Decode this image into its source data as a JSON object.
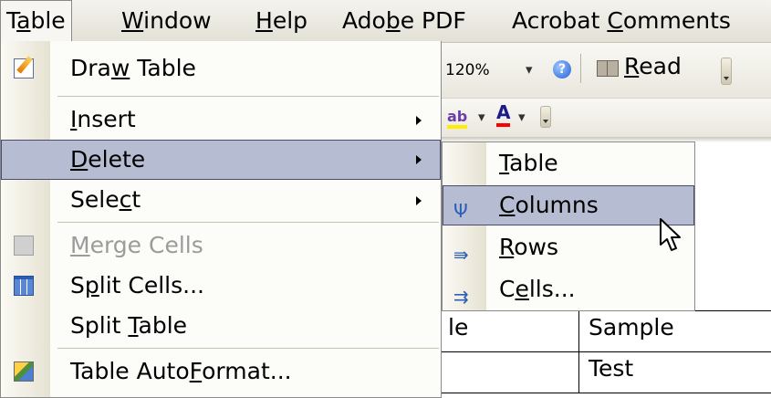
{
  "menubar": {
    "items": [
      {
        "pre": "T",
        "key": "a",
        "post": "ble"
      },
      {
        "pre": "",
        "key": "W",
        "post": "indow"
      },
      {
        "pre": "",
        "key": "H",
        "post": "elp"
      },
      {
        "pre": "Ado",
        "key": "b",
        "post": "e PDF"
      },
      {
        "pre": "Acrobat ",
        "key": "C",
        "post": "omments"
      }
    ]
  },
  "toolbar": {
    "zoom": "120%",
    "read": {
      "pre": "",
      "key": "R",
      "post": "ead"
    }
  },
  "table_menu": {
    "items": [
      {
        "pre": "Dra",
        "key": "w",
        "post": " Table",
        "icon": "draw-table-icon"
      },
      {
        "pre": "",
        "key": "I",
        "post": "nsert",
        "submenu": true
      },
      {
        "pre": "",
        "key": "D",
        "post": "elete",
        "submenu": true,
        "highlighted": true
      },
      {
        "pre": "Sele",
        "key": "c",
        "post": "t",
        "submenu": true
      },
      {
        "pre": "",
        "key": "M",
        "post": "erge Cells",
        "disabled": true,
        "icon": "merge-cells-icon"
      },
      {
        "pre": "S",
        "key": "p",
        "post": "lit Cells...",
        "icon": "split-cells-icon"
      },
      {
        "pre": "Split ",
        "key": "T",
        "post": "able"
      },
      {
        "pre": "Table Auto",
        "key": "F",
        "post": "ormat...",
        "icon": "table-autoformat-icon"
      }
    ]
  },
  "delete_submenu": {
    "items": [
      {
        "pre": "",
        "key": "T",
        "post": "able"
      },
      {
        "pre": "",
        "key": "C",
        "post": "olumns",
        "highlighted": true,
        "icon": "delete-columns-icon"
      },
      {
        "pre": "",
        "key": "R",
        "post": "ows",
        "icon": "delete-rows-icon"
      },
      {
        "pre": "C",
        "key": "e",
        "post": "lls...",
        "icon": "delete-cells-icon"
      }
    ]
  },
  "document_table": {
    "row1": [
      "le",
      "Sample"
    ],
    "row2": [
      "",
      "Test"
    ]
  },
  "colors": {
    "highlight": "#b6bdd2",
    "highlight_border": "#4b4b6f",
    "menubar": "#ece9d8"
  }
}
